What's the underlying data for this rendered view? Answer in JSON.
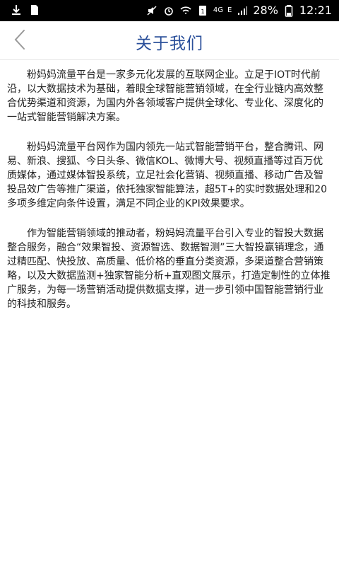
{
  "status_bar": {
    "battery_percent_text": "28%",
    "time": "12:21",
    "network_label": "4G",
    "network_small": "E",
    "icons": [
      "mute-icon",
      "alarm-icon",
      "wifi-icon",
      "sim-icon",
      "signal-icon",
      "battery-icon",
      "download-icon",
      "sd-icon"
    ]
  },
  "header": {
    "title": "关于我们"
  },
  "content": {
    "paragraphs": [
      "粉妈妈流量平台是一家多元化发展的互联网企业。立足于IOT时代前沿，以大数据技术为基础，着眼全球智能营销领域，在全行业链内高效整合优势渠道和资源，为国内外各领域客户提供全球化、专业化、深度化的一站式智能营销解决方案。",
      "粉妈妈流量平台网作为国内领先一站式智能营销平台，整合腾讯、网易、新浪、搜狐、今日头条、微信KOL、微博大号、视频直播等过百万优质媒体，通过媒体智投系统，立足社会化营销、视频直播、移动广告及智投品效广告等推广渠道，依托独家智能算法，超5T+的实时数据处理和20多项多维定向条件设置，满足不同企业的KPI效果要求。",
      "作为智能营销领域的推动者，粉妈妈流量平台引入专业的智投大数据整合服务，融合“效果智投、资源智选、数据智测”三大智投赢销理念，通过精匹配、快投放、高质量、低价格的垂直分类资源，多渠道整合营销策略，以及大数据监测+独家智能分析+直观图文展示，打造定制性的立体推广服务，为每一场营销活动提供数据支撑，进一步引领中国智能营销行业的科技和服务。"
    ]
  },
  "colors": {
    "title": "#2a4f9a",
    "text": "#222222",
    "status_bar": "#000000"
  }
}
